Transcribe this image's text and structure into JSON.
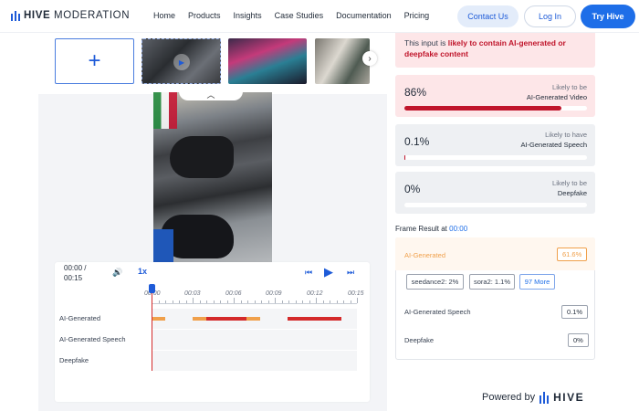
{
  "header": {
    "logo_bold": "HIVE",
    "logo_rest": " MODERATION",
    "nav": [
      "Home",
      "Products",
      "Insights",
      "Case Studies",
      "Documentation",
      "Pricing"
    ],
    "contact_label": "Contact Us",
    "login_label": "Log In",
    "try_label": "Try Hive"
  },
  "media": {
    "add_label": "+",
    "next_icon": "chevron-right-icon",
    "collapse_icon": "chevron-up-icon"
  },
  "player": {
    "time_current": "00:00 /",
    "time_total": "00:15",
    "speed": "1x",
    "icons": [
      "volume-icon",
      "skip-back-icon",
      "play-icon",
      "skip-forward-icon"
    ],
    "ticks": [
      "00:00",
      "00:03",
      "00:06",
      "00:09",
      "00:12",
      "00:15"
    ],
    "rows": [
      {
        "label": "AI-Generated"
      },
      {
        "label": "AI-Generated Speech"
      },
      {
        "label": "Deepfake"
      }
    ]
  },
  "result": {
    "alert_prefix": "This input is ",
    "alert_highlight": "likely to contain AI-generated or deepfake content",
    "cards": [
      {
        "value": "86%",
        "lbl1": "Likely to be",
        "lbl2": "AI-Generated Video",
        "fraction": 0.86
      },
      {
        "value": "0.1%",
        "lbl1": "Likely to have",
        "lbl2": "AI-Generated Speech",
        "fraction": 0.001
      },
      {
        "value": "0%",
        "lbl1": "Likely to be",
        "lbl2": "Deepfake",
        "fraction": 0.0
      }
    ],
    "frame_title": "Frame Result at ",
    "frame_time": "00:00",
    "frame": {
      "ai_label": "AI-Generated",
      "ai_value": "61.6%",
      "chips": [
        "seedance2: 2%",
        "sora2: 1.1%",
        "97 More"
      ],
      "speech_label": "AI-Generated Speech",
      "speech_value": "0.1%",
      "deepfake_label": "Deepfake",
      "deepfake_value": "0%"
    },
    "powered_by": "Powered by",
    "powered_brand": "HIVE"
  },
  "colors": {
    "accent": "#1e6ee8",
    "danger": "#c0152b",
    "orange": "#f0a04b",
    "danger_bar": "#d42a2a"
  }
}
